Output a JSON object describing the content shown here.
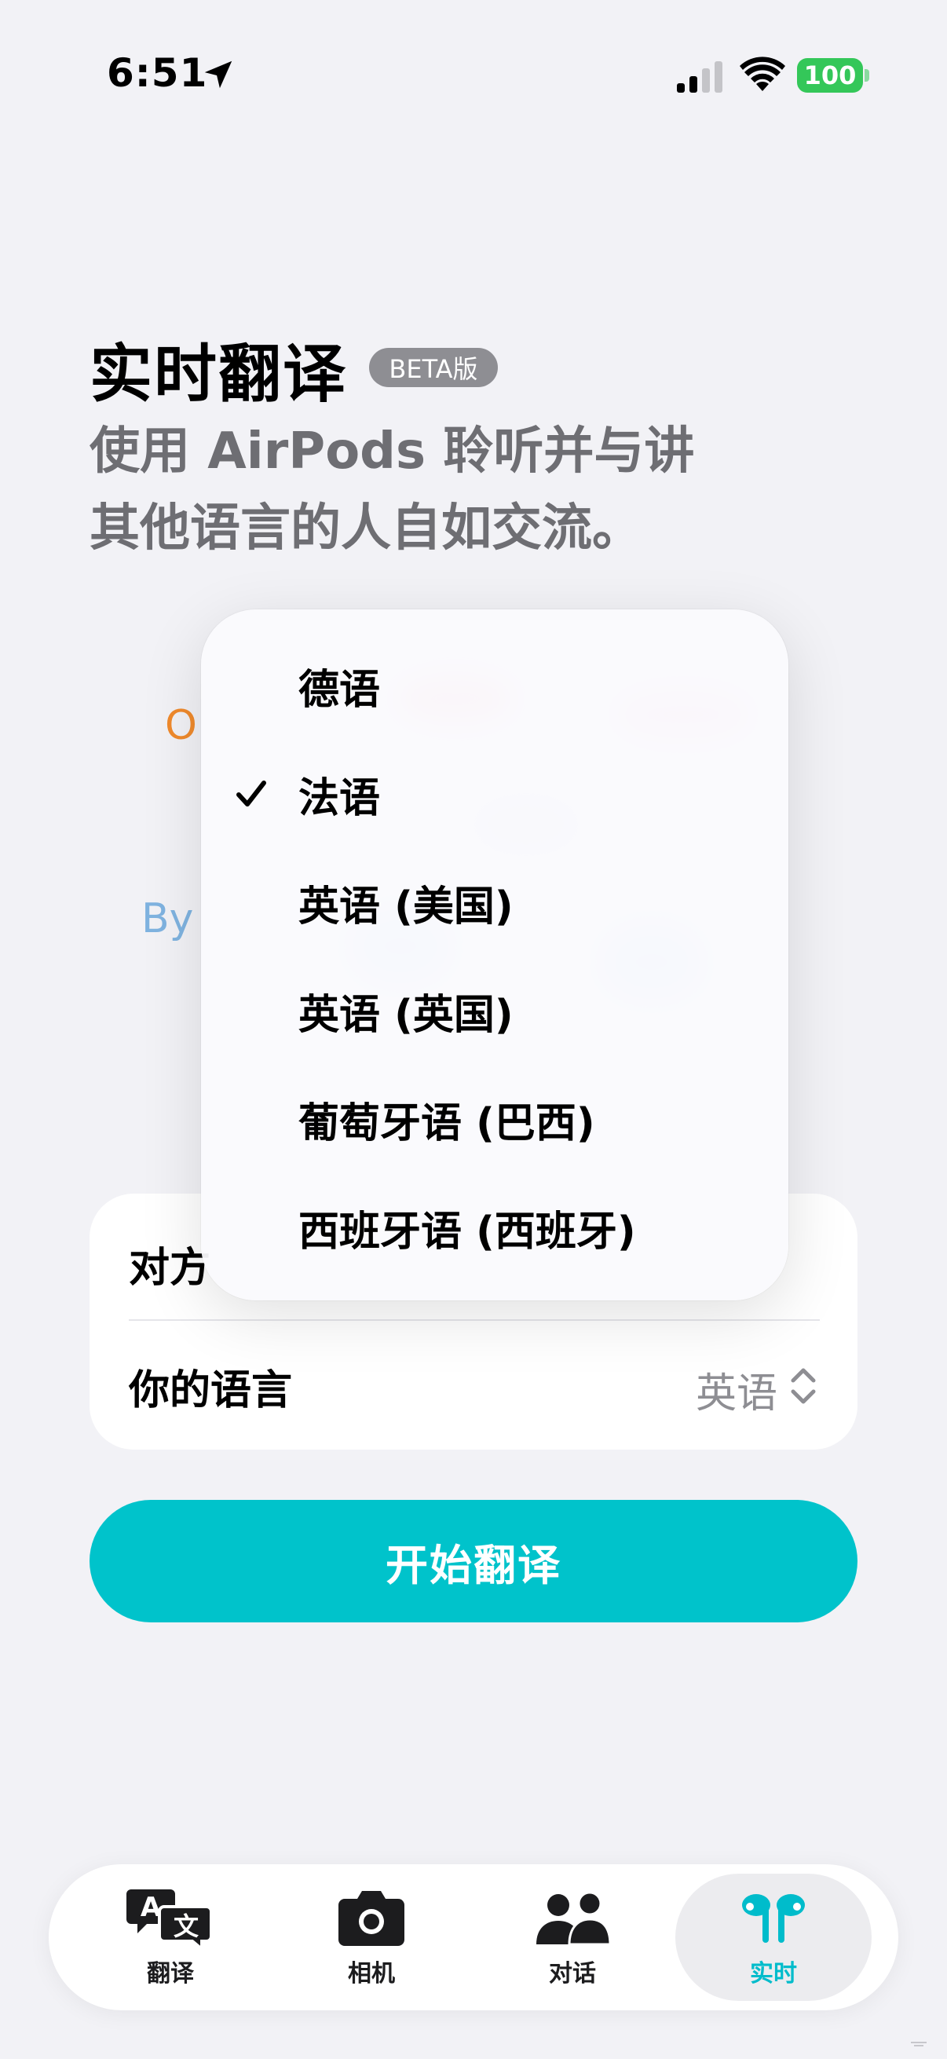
{
  "status_bar": {
    "time": "6:51",
    "battery": "100",
    "battery_color": "#34c759",
    "icons": [
      "location-arrow-icon",
      "cellular-signal-icon",
      "wifi-icon",
      "battery-icon"
    ]
  },
  "header": {
    "title": "实时翻译",
    "badge": "BETA版",
    "subtitle_line1": "使用 AirPods 聆听并与讲",
    "subtitle_line2": "其他语言的人自如交流。"
  },
  "illustration": {
    "text_o": "O",
    "text_by": "By"
  },
  "dropdown": {
    "items": [
      {
        "label": "德语",
        "selected": false
      },
      {
        "label": "法语",
        "selected": true
      },
      {
        "label": "英语 (美国)",
        "selected": false
      },
      {
        "label": "英语 (英国)",
        "selected": false
      },
      {
        "label": "葡萄牙语 (巴西)",
        "selected": false
      },
      {
        "label": "西班牙语 (西班牙)",
        "selected": false
      }
    ]
  },
  "settings": {
    "other_label": "对方",
    "your_language_label": "你的语言",
    "your_language_value": "英语"
  },
  "start_button": {
    "label": "开始翻译",
    "color": "#00c3cb"
  },
  "tab_bar": {
    "tabs": [
      {
        "label": "翻译",
        "icon": "translate-icon",
        "active": false
      },
      {
        "label": "相机",
        "icon": "camera-icon",
        "active": false
      },
      {
        "label": "对话",
        "icon": "people-icon",
        "active": false
      },
      {
        "label": "实时",
        "icon": "airpods-icon",
        "active": true
      }
    ],
    "accent": "#00bccb"
  }
}
